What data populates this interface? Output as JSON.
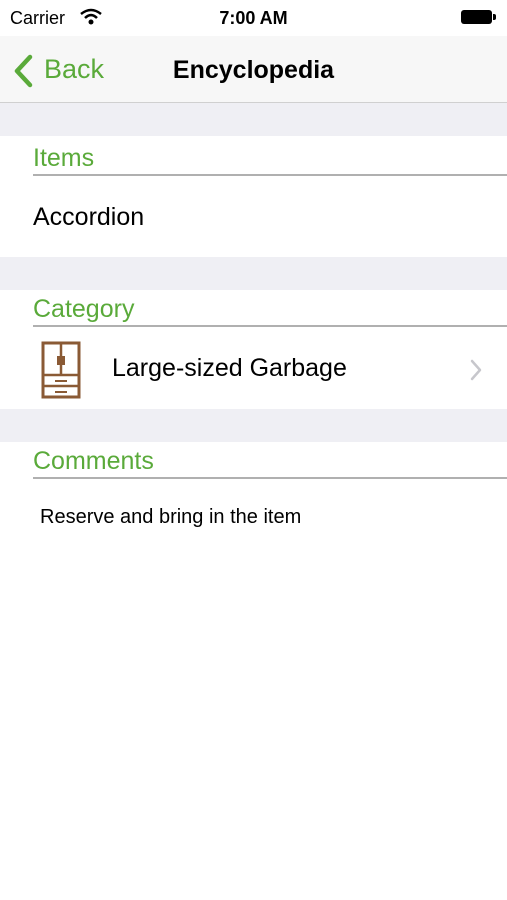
{
  "status_bar": {
    "carrier": "Carrier",
    "time": "7:00 AM"
  },
  "nav": {
    "back_label": "Back",
    "title": "Encyclopedia"
  },
  "items_section": {
    "header": "Items",
    "value": "Accordion"
  },
  "category_section": {
    "header": "Category",
    "value": "Large-sized Garbage",
    "icon": "cabinet-icon"
  },
  "comments_section": {
    "header": "Comments",
    "value": "Reserve and bring in the item"
  },
  "colors": {
    "accent": "#5aaa3a",
    "grouped_bg": "#efeff4",
    "icon_brown": "#8a5a35"
  }
}
